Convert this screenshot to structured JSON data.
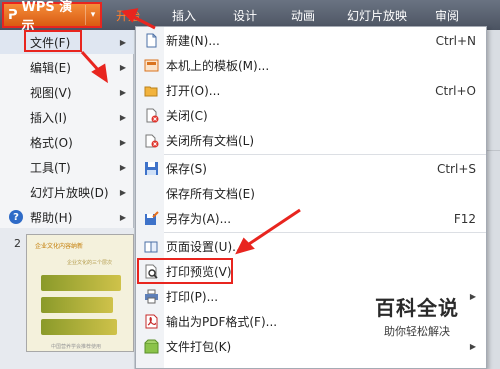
{
  "app": {
    "name": "WPS 演示",
    "logo": "ᕈ",
    "dropdown_glyph": "▾"
  },
  "ribbon_tabs": [
    {
      "label": "开始",
      "active": true
    },
    {
      "label": "插入",
      "active": false
    },
    {
      "label": "设计",
      "active": false
    },
    {
      "label": "动画",
      "active": false
    },
    {
      "label": "幻灯片放映",
      "active": false
    },
    {
      "label": "审阅",
      "active": false
    }
  ],
  "main_menu": [
    {
      "label": "文件(F)",
      "has_submenu": true,
      "selected": true
    },
    {
      "label": "编辑(E)",
      "has_submenu": true
    },
    {
      "label": "视图(V)",
      "has_submenu": true
    },
    {
      "label": "插入(I)",
      "has_submenu": true
    },
    {
      "label": "格式(O)",
      "has_submenu": true
    },
    {
      "label": "工具(T)",
      "has_submenu": true
    },
    {
      "label": "幻灯片放映(D)",
      "has_submenu": true
    },
    {
      "label": "帮助(H)",
      "has_submenu": true,
      "icon": "help-icon",
      "icon_glyph": "?"
    }
  ],
  "file_submenu": [
    {
      "label": "新建(N)...",
      "shortcut": "Ctrl+N",
      "icon": "new-document-icon"
    },
    {
      "label": "本机上的模板(M)...",
      "shortcut": "",
      "icon": "local-template-icon"
    },
    {
      "label": "打开(O)...",
      "shortcut": "Ctrl+O",
      "icon": "open-folder-icon"
    },
    {
      "label": "关闭(C)",
      "shortcut": "",
      "icon": "close-document-icon"
    },
    {
      "label": "关闭所有文档(L)",
      "shortcut": "",
      "icon": "close-all-documents-icon"
    },
    {
      "label": "保存(S)",
      "shortcut": "Ctrl+S",
      "icon": "save-icon"
    },
    {
      "label": "保存所有文档(E)",
      "shortcut": "",
      "icon": ""
    },
    {
      "label": "另存为(A)...",
      "shortcut": "F12",
      "icon": "save-as-icon"
    },
    {
      "label": "页面设置(U)...",
      "shortcut": "",
      "icon": "page-setup-icon"
    },
    {
      "label": "打印预览(V)",
      "shortcut": "",
      "icon": "print-preview-icon",
      "highlighted": true
    },
    {
      "label": "打印(P)...",
      "shortcut": "",
      "icon": "printer-icon",
      "has_submenu": true
    },
    {
      "label": "输出为PDF格式(F)...",
      "shortcut": "",
      "icon": "pdf-icon"
    },
    {
      "label": "文件打包(K)",
      "shortcut": "",
      "icon": "package-icon",
      "has_submenu": true
    }
  ],
  "slide_panel": {
    "slide_number": "2",
    "thumbnail_title": "企业文化内容纳新",
    "thumbnail_subtitle": "企业文化的三个层次",
    "thumbnail_footer": "中国营养学会推荐使用"
  },
  "watermark": {
    "main": "百科全说",
    "sub": "助你轻松解决"
  },
  "colors": {
    "accent": "#e8251f",
    "app_button": "#e8701e",
    "active_tab": "#ff7d2a",
    "menu_bg": "#f4f5f7",
    "submenu_bg": "#ffffff"
  }
}
